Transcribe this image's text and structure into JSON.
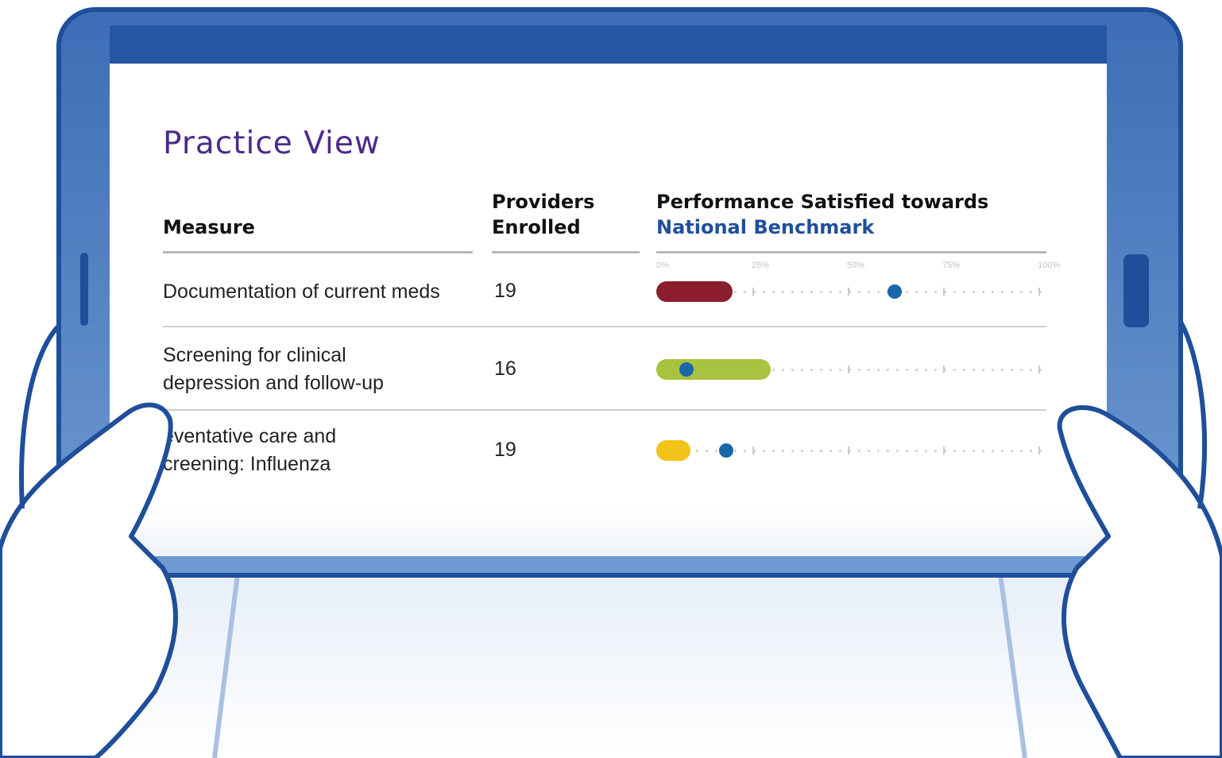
{
  "title": "Practice View",
  "columns": {
    "measure": "Measure",
    "providers_line1": "Providers",
    "providers_line2": "Enrolled",
    "performance_line1": "Performance Satisfied towards",
    "performance_line2": "National Benchmark"
  },
  "axis_ticks": [
    "0%",
    "25%",
    "50%",
    "75%",
    "100%"
  ],
  "rows": [
    {
      "measure_lines": [
        "Documentation of current meds"
      ],
      "providers": "19",
      "performance_fraction": 0.2,
      "benchmark_fraction": 0.62,
      "bar_color": "#8b1d2c"
    },
    {
      "measure_lines": [
        "Screening for clinical",
        "depression and follow-up"
      ],
      "providers": "16",
      "performance_fraction": 0.3,
      "benchmark_fraction": 0.075,
      "bar_color": "#a9c23f"
    },
    {
      "measure_lines": [
        "eventative care and",
        "creening: Influenza"
      ],
      "providers": "19",
      "performance_fraction": 0.09,
      "benchmark_fraction": 0.18,
      "bar_color": "#f2c318"
    }
  ],
  "colors": {
    "title": "#4d2a8c",
    "benchmark_label": "#1f4f9c",
    "benchmark_dot": "#1967a8",
    "device_frame": "#2456a4",
    "device_body": "#4f7fc0",
    "hand_outline": "#1f4e9a"
  },
  "icons": [
    "tablet-device",
    "left-hand",
    "right-hand",
    "benchmark-dot"
  ]
}
